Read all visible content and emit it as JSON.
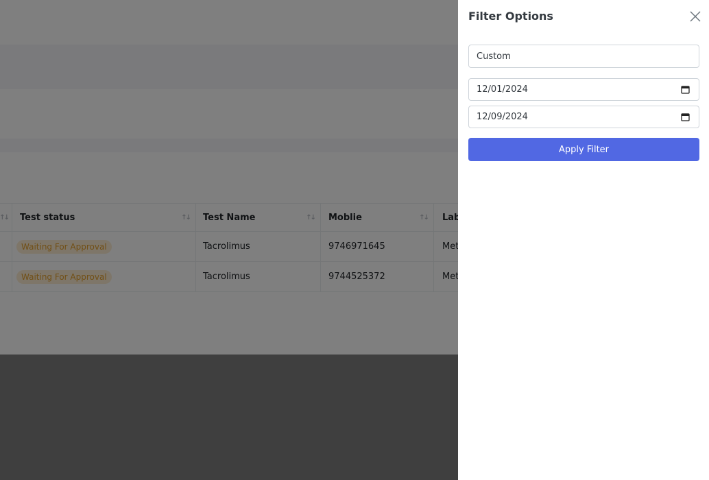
{
  "table": {
    "columns": [
      "Test status",
      "Test Name",
      "Moblie",
      "Lab"
    ],
    "rows": [
      {
        "status": "Waiting For Approval",
        "test_name": "Tacrolimus",
        "mobile": "9746971645",
        "lab": "Met"
      },
      {
        "status": "Waiting For Approval",
        "test_name": "Tacrolimus",
        "mobile": "9744525372",
        "lab": "Met"
      }
    ]
  },
  "filter_panel": {
    "title": "Filter Options",
    "close_icon": "close-icon",
    "range_select": {
      "value": "Custom"
    },
    "from_date": {
      "value": "12/01/2024",
      "icon": "calendar-icon"
    },
    "to_date": {
      "value": "12/09/2024",
      "icon": "calendar-icon"
    },
    "apply_label": "Apply Filter",
    "accent_color": "#5168e3"
  }
}
